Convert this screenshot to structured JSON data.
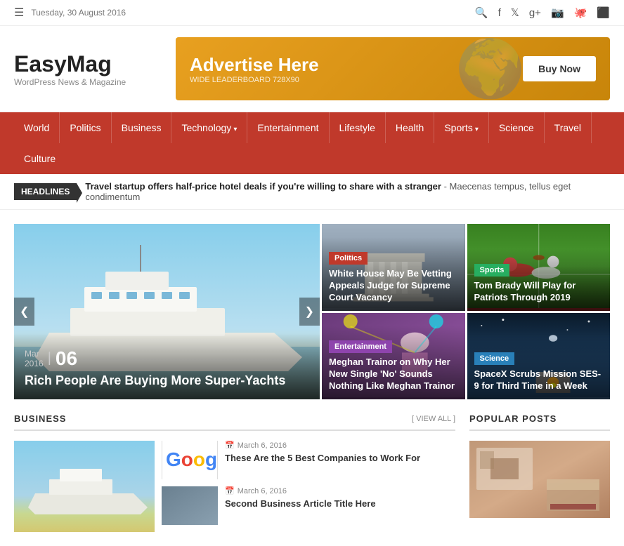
{
  "topbar": {
    "date": "Tuesday, 30 August 2016",
    "icons": [
      "search",
      "facebook",
      "twitter",
      "google-plus",
      "instagram",
      "github",
      "flickr"
    ]
  },
  "header": {
    "logo": "EasyMag",
    "tagline": "WordPress News & Magazine",
    "ad": {
      "title": "Advertise Here",
      "subtitle": "WIDE LEADERBOARD 728X90",
      "buy_button": "Buy Now"
    }
  },
  "nav": {
    "items": [
      {
        "label": "World",
        "has_arrow": false
      },
      {
        "label": "Politics",
        "has_arrow": false
      },
      {
        "label": "Business",
        "has_arrow": false
      },
      {
        "label": "Technology",
        "has_arrow": true
      },
      {
        "label": "Entertainment",
        "has_arrow": false
      },
      {
        "label": "Lifestyle",
        "has_arrow": false
      },
      {
        "label": "Health",
        "has_arrow": false
      },
      {
        "label": "Sports",
        "has_arrow": true
      },
      {
        "label": "Science",
        "has_arrow": false
      },
      {
        "label": "Travel",
        "has_arrow": false
      },
      {
        "label": "Culture",
        "has_arrow": false
      }
    ]
  },
  "headlines": {
    "label": "HEADLINES",
    "text": "Travel startup offers half-price hotel deals if you're willing to share with a stranger",
    "suffix": "- Maecenas tempus, tellus eget condimentum"
  },
  "featured": {
    "main": {
      "date_month": "Mar",
      "date_year": "2016",
      "date_num": "06",
      "title": "Rich People Are Buying More Super-Yachts",
      "prev": "❮",
      "next": "❯"
    },
    "side": [
      {
        "id": "politics-card",
        "category": "Politics",
        "cat_class": "cat-politics",
        "img_class": "politics-bg",
        "title": "White House May Be Vetting Appeals Judge for Supreme Court Vacancy"
      },
      {
        "id": "entertainment-card",
        "category": "Entertainment",
        "cat_class": "cat-entertainment",
        "img_class": "entertainment-bg",
        "title": "Meghan Trainor on Why Her New Single 'No' Sounds Nothing Like Meghan Trainor"
      },
      {
        "id": "sports-card",
        "category": "Sports",
        "cat_class": "cat-sports",
        "img_class": "sports-bg",
        "title": "Tom Brady Will Play for Patriots Through 2019"
      },
      {
        "id": "science-card",
        "category": "Science",
        "cat_class": "cat-science",
        "img_class": "science-bg",
        "title": "SpaceX Scrubs Mission SES-9 for Third Time in a Week"
      }
    ]
  },
  "business": {
    "section_title": "BUSINESS",
    "view_all": "[ VIEW ALL ]",
    "articles": [
      {
        "date": "March 6, 2016",
        "title": "These Are the 5 Best Companies to Work For",
        "thumb_type": "google"
      },
      {
        "date": "March 6, 2016",
        "title": "Second Business Article Title Here",
        "thumb_type": "default"
      }
    ]
  },
  "popular": {
    "section_title": "POPULAR POSTS"
  }
}
